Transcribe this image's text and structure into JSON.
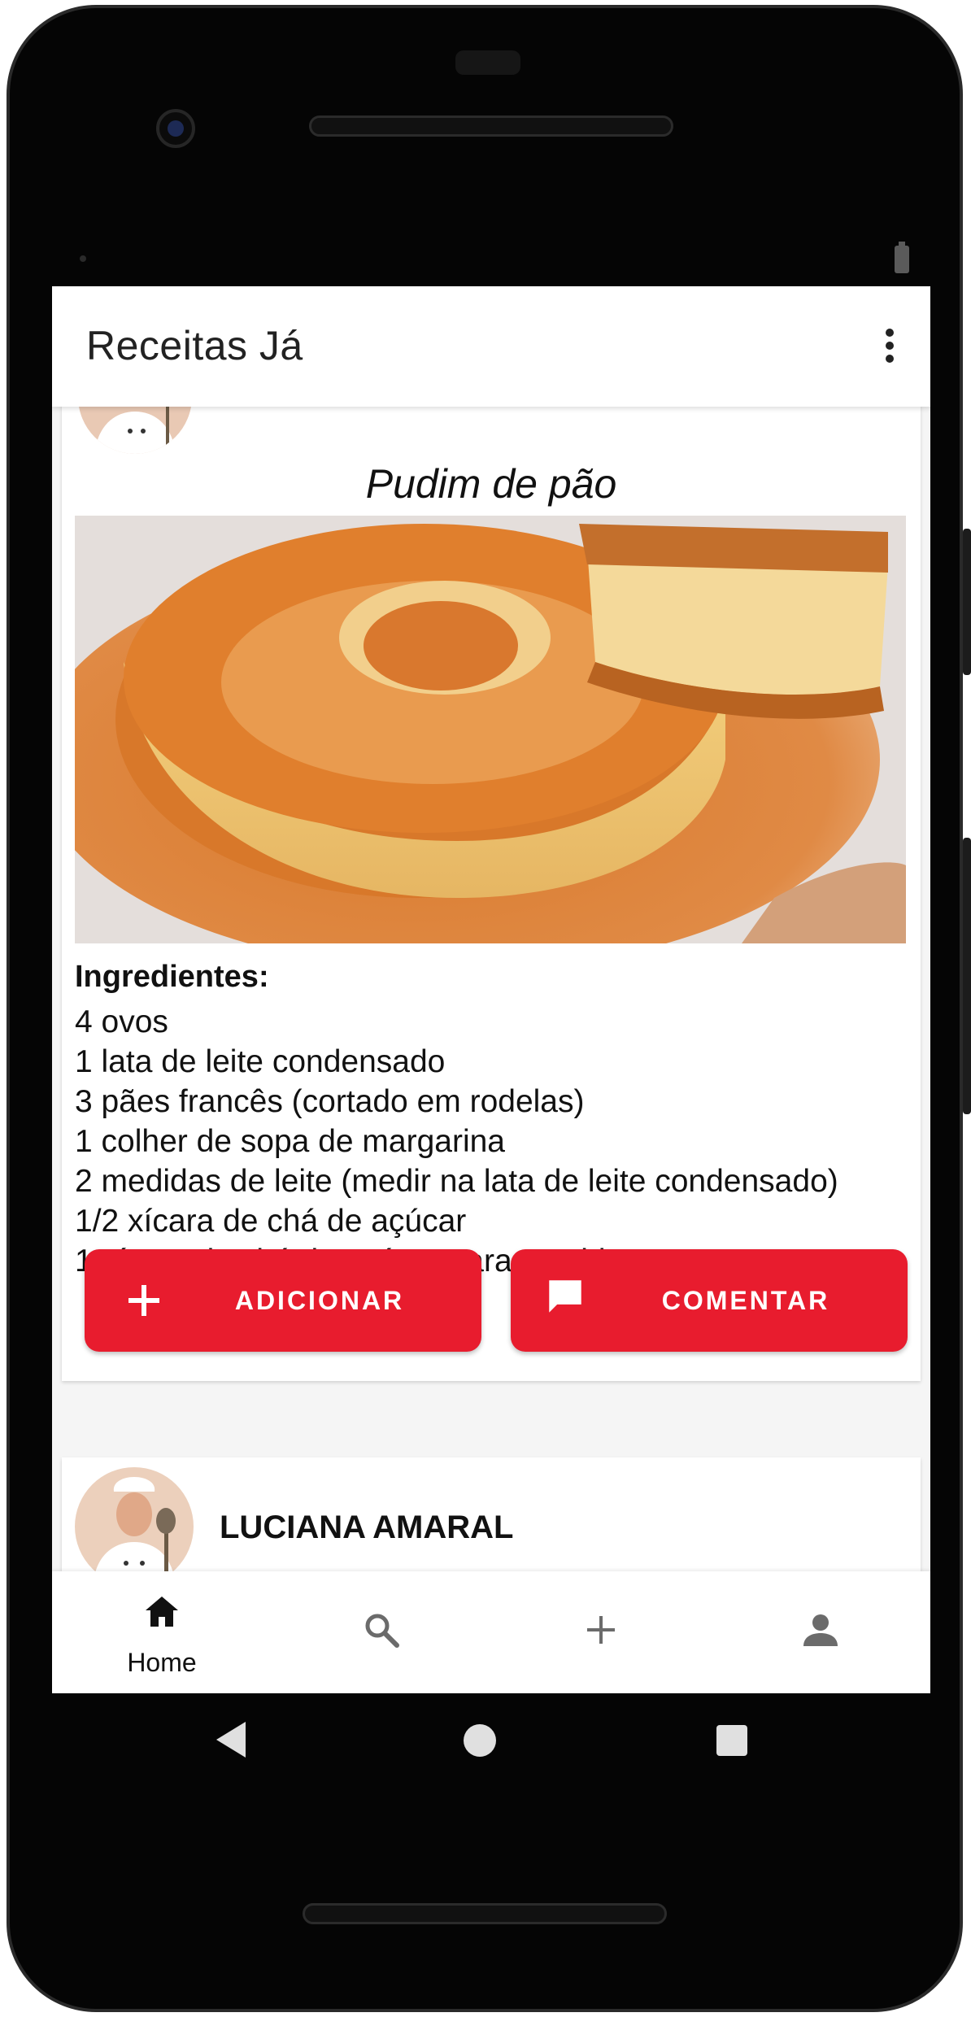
{
  "app": {
    "title": "Receitas Já",
    "menu_icon": "more-vert-icon"
  },
  "recipe": {
    "title": "Pudim de pão",
    "ingredients_heading": "Ingredientes:",
    "ingredients": [
      "4 ovos",
      "1 lata de leite condensado",
      "3 pães francês (cortado em rodelas)",
      "1 colher de sopa de margarina",
      "2 medidas de leite (medir na lata de leite condensado)",
      "1/2 xícara de chá de açúcar",
      "1 xícara de chá de açúcar para a calda"
    ],
    "buttons": {
      "add_label": "ADICIONAR",
      "add_icon": "plus-icon",
      "comment_label": "COMENTAR",
      "comment_icon": "comment-icon"
    }
  },
  "next_post": {
    "author": "LUCIANA AMARAL"
  },
  "bottom_nav": {
    "items": [
      {
        "label": "Home",
        "icon": "home-icon",
        "active": true
      },
      {
        "label": "",
        "icon": "search-icon"
      },
      {
        "label": "",
        "icon": "add-icon"
      },
      {
        "label": "",
        "icon": "person-icon"
      }
    ]
  },
  "colors": {
    "accent": "#e81c2e",
    "app_bar": "#ffffff",
    "background": "#f5f5f5",
    "text": "#111111"
  }
}
